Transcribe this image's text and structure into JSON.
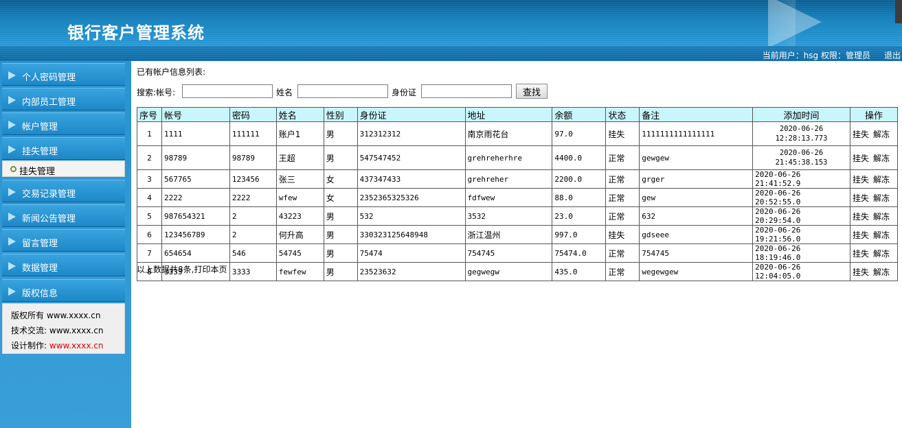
{
  "header": {
    "title": "银行客户管理系统"
  },
  "status": {
    "user_text": "当前用户：hsg 权限：管理员",
    "logout": "退出"
  },
  "sidebar": {
    "items": [
      {
        "label": "个人密码管理"
      },
      {
        "label": "内部员工管理"
      },
      {
        "label": "帐户管理"
      },
      {
        "label": "挂失管理"
      },
      {
        "label": "交易记录管理"
      },
      {
        "label": "新闻公告管理"
      },
      {
        "label": "留言管理"
      },
      {
        "label": "数据管理"
      },
      {
        "label": "版权信息"
      }
    ],
    "submenu": {
      "label": "挂失管理"
    },
    "copyright": {
      "line1_label": "版权所有",
      "line1_value": "www.xxxx.cn",
      "line2_label": "技术交流:",
      "line2_value": "www.xxxx.cn",
      "line3_label": "设计制作:",
      "line3_value": "www.xxxx.cn",
      "line3_color": "#e00000"
    }
  },
  "main": {
    "list_title": "已有帐户信息列表:",
    "search": {
      "label_prefix": "搜索:帐号:",
      "name_label": "姓名",
      "id_label": "身份证",
      "account_value": "",
      "name_value": "",
      "id_value": "",
      "button": "查找"
    },
    "table": {
      "headers": [
        "序号",
        "帐号",
        "密码",
        "姓名",
        "性别",
        "身份证",
        "地址",
        "余额",
        "状态",
        "备注",
        "添加时间",
        "操作"
      ],
      "rows": [
        {
          "no": "1",
          "account": "1111",
          "password": "111111",
          "name": "账户1",
          "sex": "男",
          "idcard": "312312312",
          "address": "南京雨花台",
          "balance": "97.0",
          "status": "挂失",
          "note": "1111111111111111",
          "date": "2020-06-26",
          "time": "12:28:13.773",
          "op1": "挂失",
          "op2": "解冻"
        },
        {
          "no": "2",
          "account": "98789",
          "password": "98789",
          "name": "王超",
          "sex": "男",
          "idcard": "547547452",
          "address": "grehreherhre",
          "balance": "4400.0",
          "status": "正常",
          "note": "gewgew",
          "date": "2020-06-26",
          "time": "21:45:38.153",
          "op1": "挂失",
          "op2": "解冻"
        },
        {
          "no": "3",
          "account": "567765",
          "password": "123456",
          "name": "张三",
          "sex": "女",
          "idcard": "437347433",
          "address": "grehreher",
          "balance": "2200.0",
          "status": "正常",
          "note": "grger",
          "datetime": "2020-06-26 21:41:52.9",
          "op1": "挂失",
          "op2": "解冻"
        },
        {
          "no": "4",
          "account": "2222",
          "password": "2222",
          "name": "wfew",
          "sex": "女",
          "idcard": "2352365325326",
          "address": "fdfwew",
          "balance": "88.0",
          "status": "正常",
          "note": "gew",
          "datetime": "2020-06-26 20:52:55.0",
          "op1": "挂失",
          "op2": "解冻"
        },
        {
          "no": "5",
          "account": "987654321",
          "password": "2",
          "name": "43223",
          "sex": "男",
          "idcard": "532",
          "address": "3532",
          "balance": "23.0",
          "status": "正常",
          "note": "632",
          "datetime": "2020-06-26 20:29:54.0",
          "op1": "挂失",
          "op2": "解冻"
        },
        {
          "no": "6",
          "account": "123456789",
          "password": "2",
          "name": "何升高",
          "sex": "男",
          "idcard": "330323125648948",
          "address": "浙江温州",
          "balance": "997.0",
          "status": "挂失",
          "note": "gdseee",
          "datetime": "2020-06-26 19:21:56.0",
          "op1": "挂失",
          "op2": "解冻"
        },
        {
          "no": "7",
          "account": "654654",
          "password": "546",
          "name": "54745",
          "sex": "男",
          "idcard": "75474",
          "address": "754745",
          "balance": "75474.0",
          "status": "正常",
          "note": "754745",
          "datetime": "2020-06-26 18:19:46.0",
          "op1": "挂失",
          "op2": "解冻"
        },
        {
          "no": "8",
          "account": "3333",
          "password": "3333",
          "name": "fewfew",
          "sex": "男",
          "idcard": "23523632",
          "address": "gegwegw",
          "balance": "435.0",
          "status": "正常",
          "note": "wegewgew",
          "datetime": "2020-06-26 12:04:05.0",
          "op1": "挂失",
          "op2": "解冻"
        }
      ]
    },
    "footer_note": "以上数据共8条,打印本页"
  },
  "colors": {
    "header_blue": "#1680bd",
    "sidebar_blue": "#2a93d0",
    "table_header_bg": "#c9f6fc"
  }
}
